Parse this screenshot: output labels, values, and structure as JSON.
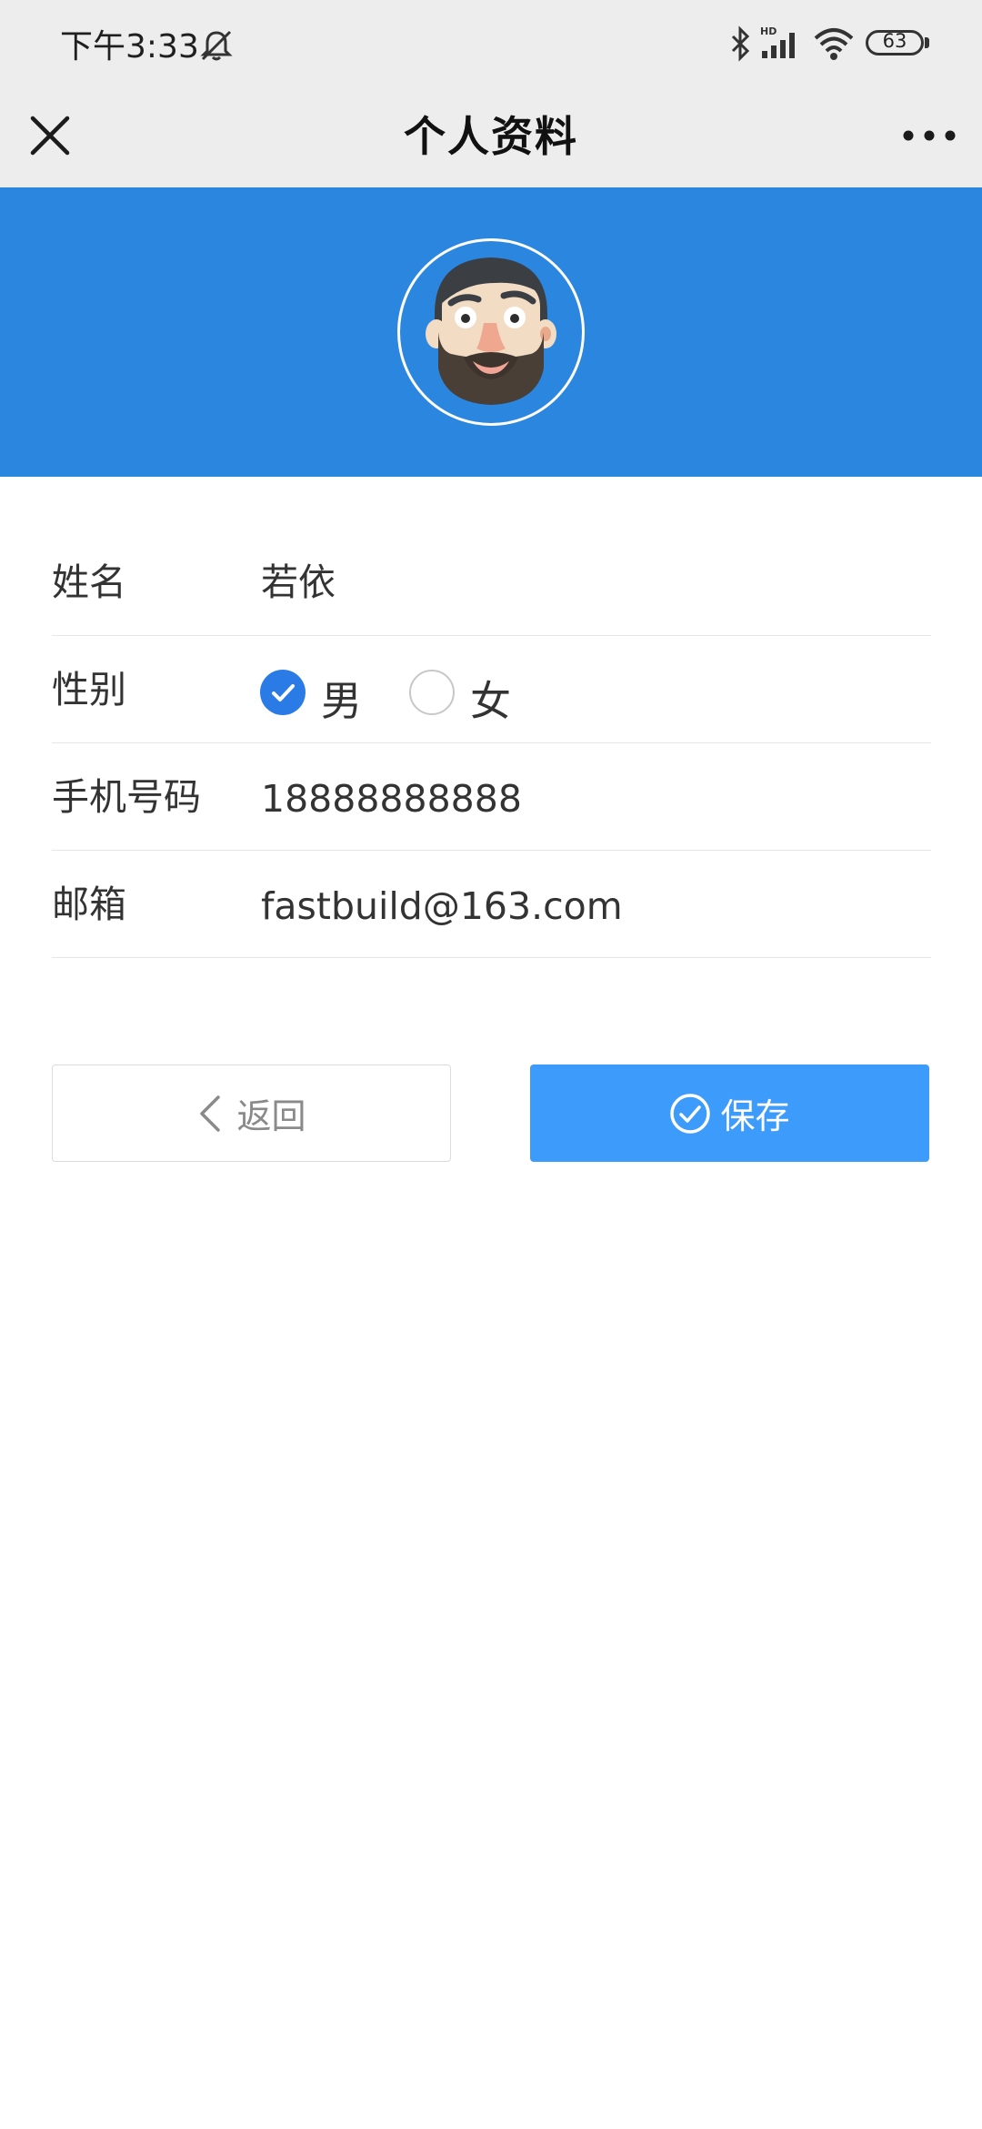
{
  "status_bar": {
    "time": "下午3:33",
    "battery": "63",
    "icons": [
      "mute-bell-icon",
      "bluetooth-icon",
      "hd-signal-icon",
      "wifi-icon",
      "battery-icon"
    ]
  },
  "title_bar": {
    "title": "个人资料",
    "left_icon": "close-icon",
    "right_icon": "more-icon"
  },
  "header": {
    "background_color": "#2b86e0",
    "avatar_icon": "bearded-man-avatar"
  },
  "form": {
    "name": {
      "label": "姓名",
      "value": "若依"
    },
    "gender": {
      "label": "性别",
      "options": [
        {
          "label": "男",
          "checked": true
        },
        {
          "label": "女",
          "checked": false
        }
      ]
    },
    "phone": {
      "label": "手机号码",
      "value": "18888888888"
    },
    "email": {
      "label": "邮箱",
      "value": "fastbuild@163.com"
    }
  },
  "buttons": {
    "back": {
      "label": "返回",
      "icon": "chevron-left-icon"
    },
    "save": {
      "label": "保存",
      "icon": "check-circle-icon",
      "color": "#3d9bfb"
    }
  },
  "colors": {
    "accent": "#2b7be6",
    "bar_background": "#ededed"
  }
}
